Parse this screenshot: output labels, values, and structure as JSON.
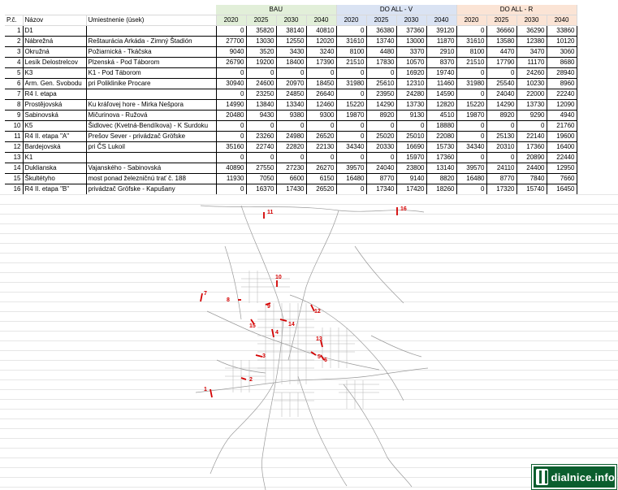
{
  "groups": {
    "bau": "BAU",
    "do_all_v": "DO ALL - V",
    "do_all_r": "DO ALL - R"
  },
  "headers": {
    "pc": "P.č.",
    "nazov": "Názov",
    "umiestnenie": "Umiestnenie (úsek)"
  },
  "years": [
    "2020",
    "2025",
    "2030",
    "2040"
  ],
  "rows": [
    {
      "n": "1",
      "name": "D1",
      "loc": "",
      "bau": [
        "0",
        "35820",
        "38140",
        "40810"
      ],
      "v": [
        "0",
        "36380",
        "37360",
        "39120"
      ],
      "r": [
        "0",
        "36660",
        "36290",
        "33860"
      ]
    },
    {
      "n": "2",
      "name": "Nábrežná",
      "loc": "Reštaurácia Arkáda - Zimný Štadión",
      "bau": [
        "27700",
        "13030",
        "12550",
        "12020"
      ],
      "v": [
        "31610",
        "13740",
        "13000",
        "11870"
      ],
      "r": [
        "31610",
        "13580",
        "12380",
        "10120"
      ]
    },
    {
      "n": "3",
      "name": "Okružná",
      "loc": "Požiarnická - Tkáčska",
      "bau": [
        "9040",
        "3520",
        "3430",
        "3240"
      ],
      "v": [
        "8100",
        "4480",
        "3370",
        "2910"
      ],
      "r": [
        "8100",
        "4470",
        "3470",
        "3060"
      ]
    },
    {
      "n": "4",
      "name": "Lesík Delostrelcov",
      "loc": "Plzenská - Pod Táborom",
      "bau": [
        "26790",
        "19200",
        "18400",
        "17390"
      ],
      "v": [
        "21510",
        "17830",
        "10570",
        "8370"
      ],
      "r": [
        "21510",
        "17790",
        "11170",
        "8680"
      ]
    },
    {
      "n": "5",
      "name": "K3",
      "loc": "K1 - Pod Táborom",
      "bau": [
        "0",
        "0",
        "0",
        "0"
      ],
      "v": [
        "0",
        "0",
        "16920",
        "19740"
      ],
      "r": [
        "0",
        "0",
        "24260",
        "28940"
      ]
    },
    {
      "n": "6",
      "name": "Arm. Gen. Svobodu",
      "loc": "pri Poliklinike Procare",
      "bau": [
        "30940",
        "24600",
        "20970",
        "18450"
      ],
      "v": [
        "31980",
        "25610",
        "12310",
        "11460"
      ],
      "r": [
        "31980",
        "25540",
        "10230",
        "8960"
      ]
    },
    {
      "n": "7",
      "name": "R4 I. etapa",
      "loc": "",
      "bau": [
        "0",
        "23250",
        "24850",
        "26640"
      ],
      "v": [
        "0",
        "23950",
        "24280",
        "14590"
      ],
      "r": [
        "0",
        "24040",
        "22000",
        "22240"
      ]
    },
    {
      "n": "8",
      "name": "Prostějovská",
      "loc": "Ku kráľovej hore - Mirka Nešpora",
      "bau": [
        "14990",
        "13840",
        "13340",
        "12460"
      ],
      "v": [
        "15220",
        "14290",
        "13730",
        "12820"
      ],
      "r": [
        "15220",
        "14290",
        "13730",
        "12090"
      ]
    },
    {
      "n": "9",
      "name": "Sabinovská",
      "loc": "Mičurinova - Ružová",
      "bau": [
        "20480",
        "9430",
        "9380",
        "9300"
      ],
      "v": [
        "19870",
        "8920",
        "9130",
        "4510"
      ],
      "r": [
        "19870",
        "8920",
        "9290",
        "4940"
      ]
    },
    {
      "n": "10",
      "name": "K5",
      "loc": "Šidlovec (Kvetná-Bendíkova) - K Surdoku",
      "bau": [
        "0",
        "0",
        "0",
        "0"
      ],
      "v": [
        "0",
        "0",
        "0",
        "18880"
      ],
      "r": [
        "0",
        "0",
        "0",
        "21760"
      ]
    },
    {
      "n": "11",
      "name": "R4 II. etapa \"A\"",
      "loc": "Prešov Sever - privádzač Gröfske",
      "bau": [
        "0",
        "23260",
        "24980",
        "26520"
      ],
      "v": [
        "0",
        "25020",
        "25010",
        "22080"
      ],
      "r": [
        "0",
        "25130",
        "22140",
        "19600"
      ]
    },
    {
      "n": "12",
      "name": "Bardejovská",
      "loc": "pri ČS Lukoil",
      "bau": [
        "35160",
        "22740",
        "22820",
        "22130"
      ],
      "v": [
        "34340",
        "20330",
        "16690",
        "15730"
      ],
      "r": [
        "34340",
        "20310",
        "17360",
        "16400"
      ]
    },
    {
      "n": "13",
      "name": "K1",
      "loc": "",
      "bau": [
        "0",
        "0",
        "0",
        "0"
      ],
      "v": [
        "0",
        "0",
        "15970",
        "17360"
      ],
      "r": [
        "0",
        "0",
        "20890",
        "22440"
      ]
    },
    {
      "n": "14",
      "name": "Duklianska",
      "loc": "Vajanského - Sabinovská",
      "bau": [
        "40890",
        "27550",
        "27230",
        "26270"
      ],
      "v": [
        "39570",
        "24040",
        "23800",
        "13140"
      ],
      "r": [
        "39570",
        "24110",
        "24400",
        "12950"
      ]
    },
    {
      "n": "15",
      "name": "Škultétyho",
      "loc": "most ponad železničnú trať č. 188",
      "bau": [
        "11930",
        "7050",
        "6600",
        "6150"
      ],
      "v": [
        "16480",
        "8770",
        "9140",
        "8820"
      ],
      "r": [
        "16480",
        "8770",
        "7840",
        "7660"
      ]
    },
    {
      "n": "16",
      "name": "R4 II. etapa \"B\"",
      "loc": "privádzač Gröfske - Kapušany",
      "bau": [
        "0",
        "16370",
        "17430",
        "26520"
      ],
      "v": [
        "0",
        "17340",
        "17420",
        "18260"
      ],
      "r": [
        "0",
        "17320",
        "15740",
        "16450"
      ]
    }
  ],
  "map": {
    "labels": [
      "11",
      "16",
      "10",
      "7",
      "8",
      "9",
      "12",
      "4",
      "13",
      "3",
      "5",
      "6",
      "2",
      "1",
      "14",
      "15"
    ]
  },
  "logo": {
    "text": "dialnice.info"
  },
  "colors": {
    "bau": "#e2efd9",
    "do_all_v": "#dae3f3",
    "do_all_r": "#fbe4d5",
    "marker": "#d40000",
    "logo": "#0b5e2e"
  }
}
